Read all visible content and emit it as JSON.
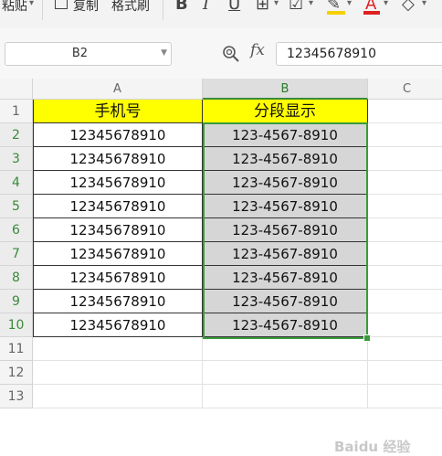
{
  "toolbar": {
    "paste_label": "粘贴",
    "copy_label": "复制",
    "format_painter_label": "格式刷",
    "bold_label": "B",
    "italic_label": "I",
    "underline_label": "U",
    "font_color_label": "A",
    "font_color_hex": "#e02020",
    "fill_color_hex": "#f5d000"
  },
  "formula_bar": {
    "name_box": "B2",
    "fx_label": "fx",
    "formula_value": "12345678910"
  },
  "columns": [
    "A",
    "B",
    "C"
  ],
  "active_column": "B",
  "rows": [
    "1",
    "2",
    "3",
    "4",
    "5",
    "6",
    "7",
    "8",
    "9",
    "10",
    "11",
    "12",
    "13"
  ],
  "table": {
    "header": [
      "手机号",
      "分段显示"
    ],
    "data": [
      [
        "12345678910",
        "123-4567-8910"
      ],
      [
        "12345678910",
        "123-4567-8910"
      ],
      [
        "12345678910",
        "123-4567-8910"
      ],
      [
        "12345678910",
        "123-4567-8910"
      ],
      [
        "12345678910",
        "123-4567-8910"
      ],
      [
        "12345678910",
        "123-4567-8910"
      ],
      [
        "12345678910",
        "123-4567-8910"
      ],
      [
        "12345678910",
        "123-4567-8910"
      ],
      [
        "12345678910",
        "123-4567-8910"
      ]
    ]
  },
  "colors": {
    "header_fill": "#ffff00",
    "selection_border": "#3a9a3a",
    "selected_fill": "#d6d6d6"
  },
  "watermark": "Baidu 经验"
}
